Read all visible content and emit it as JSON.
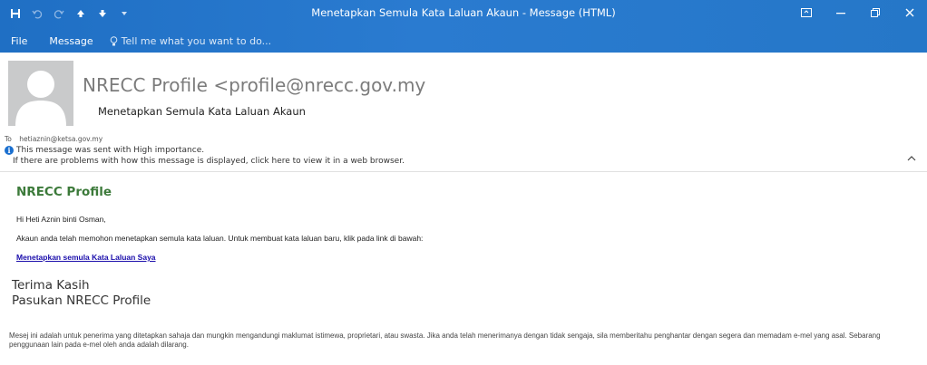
{
  "window": {
    "title": "Menetapkan Semula Kata Laluan Akaun - Message (HTML)",
    "accent_color": "#2577c8"
  },
  "qat": {
    "icons": [
      "save-icon",
      "undo-icon",
      "redo-icon",
      "up-arrow-icon",
      "down-arrow-icon",
      "customize-icon"
    ]
  },
  "ribbon": {
    "tabs": [
      "File",
      "Message"
    ],
    "tell_me": "Tell me what you want to do..."
  },
  "header": {
    "sender": "NRECC Profile <profile@nrecc.gov.my",
    "subject": "Menetapkan Semula Kata Laluan Akaun",
    "to_label": "To",
    "to_address": "hetiaznin@ketsa.gov.my",
    "importance": "This message was sent with High importance.",
    "view_in_browser": "If there are problems with how this message is displayed, click here to view it in a web browser."
  },
  "body": {
    "brand": "NRECC Profile",
    "greeting": "Hi Heti Aznin binti Osman,",
    "paragraph": "Akaun anda telah memohon menetapkan semula kata laluan. Untuk membuat kata laluan baru, klik pada link di bawah:",
    "reset_link": "Menetapkan semula Kata Laluan Saya",
    "thanks_line1": "Terima Kasih",
    "thanks_line2": "Pasukan NRECC Profile",
    "disclaimer": "Mesej ini adalah untuk penerima yang ditetapkan sahaja dan mungkin mengandungi maklumat istimewa, proprietari, atau swasta. Jika anda telah menerimanya dengan tidak sengaja, sila memberitahu penghantar dengan segera dan memadam e-mel yang asal. Sebarang penggunaan lain pada e-mel oleh anda adalah dilarang."
  }
}
